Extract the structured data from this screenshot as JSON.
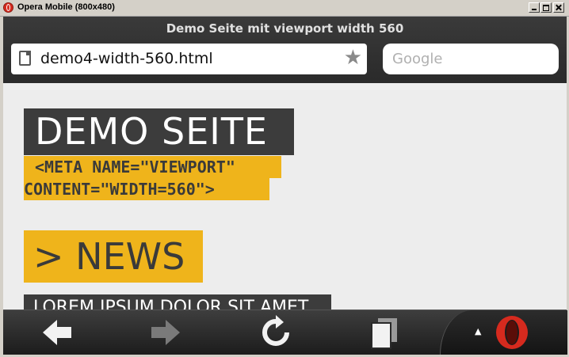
{
  "window": {
    "title": "Opera Mobile (800x480)"
  },
  "browser": {
    "page_title": "Demo Seite mit viewport width 560",
    "url": "demo4-width-560.html",
    "search_placeholder": "Google"
  },
  "page": {
    "heading": "DEMO SEITE",
    "meta_line1": "<META NAME=\"VIEWPORT\"",
    "meta_line2": "CONTENT=\"WIDTH=560\">",
    "news_heading": "> NEWS",
    "lorem_heading": "LOREM IPSUM DOLOR SIT AMET"
  },
  "toolbar": {
    "icons": [
      "back-arrow-icon",
      "forward-arrow-icon",
      "reload-icon",
      "tabs-icon",
      "opera-menu-icon"
    ]
  },
  "colors": {
    "accent_yellow": "#efb41b",
    "dark_block": "#3c3c3c",
    "page_background": "#ededed",
    "opera_red": "#d62a1e"
  }
}
